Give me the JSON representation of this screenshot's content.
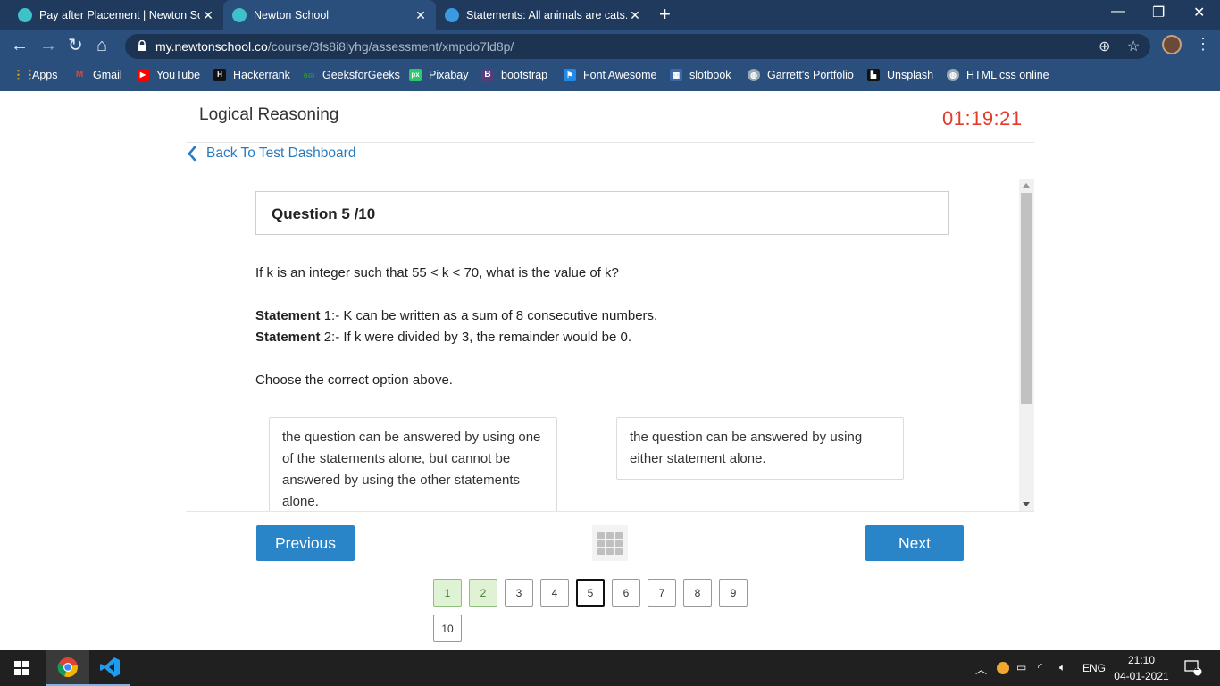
{
  "browser": {
    "tabs": [
      {
        "title": "Pay after Placement | Newton Sch",
        "active": false
      },
      {
        "title": "Newton School",
        "active": true
      },
      {
        "title": "Statements: All animals are cats. S",
        "active": false
      }
    ],
    "url_host": "my.newtonschool.co",
    "url_path": "/course/3fs8i8lyhg/assessment/xmpdo7ld8p/",
    "bookmarks": [
      "Apps",
      "Gmail",
      "YouTube",
      "Hackerrank",
      "GeeksforGeeks",
      "Pixabay",
      "bootstrap",
      "Font Awesome",
      "slotbook",
      "Garrett's Portfolio",
      "Unsplash",
      "HTML css online"
    ]
  },
  "page": {
    "title": "Logical Reasoning",
    "timer": "01:19:21",
    "back_label": "Back To Test Dashboard"
  },
  "question": {
    "header": "Question 5 /10",
    "prompt": "If k is an integer such that 55 < k < 70, what is the value of k?",
    "statements": [
      {
        "label": "Statement",
        "text": " 1:- K can be written as a sum of 8 consecutive numbers."
      },
      {
        "label": "Statement",
        "text": " 2:- If k were divided by 3, the remainder would be 0."
      }
    ],
    "instruction": "Choose the correct option above.",
    "options": [
      "the question can be answered by using one of the statements alone, but cannot be answered by using the other statements alone.",
      "the question can be answered by using either statement alone."
    ]
  },
  "controls": {
    "previous_label": "Previous",
    "next_label": "Next"
  },
  "question_nav": {
    "items": [
      "1",
      "2",
      "3",
      "4",
      "5",
      "6",
      "7",
      "8",
      "9",
      "10"
    ],
    "answered": [
      "1",
      "2"
    ],
    "current": "5"
  },
  "taskbar": {
    "language": "ENG",
    "time": "21:10",
    "date": "04-01-2021",
    "notification_count": "1"
  }
}
